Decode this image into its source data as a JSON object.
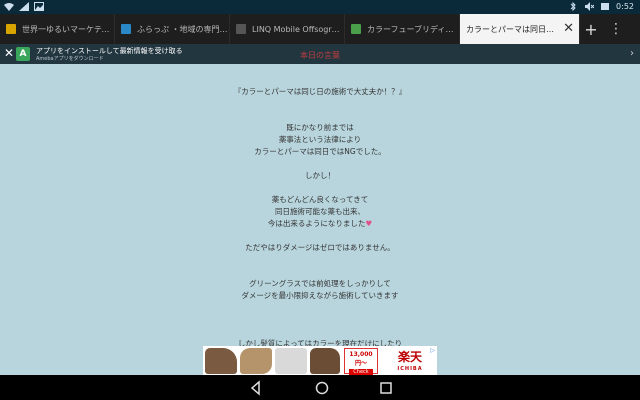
{
  "status_bar": {
    "time": "0:52",
    "icons": [
      "wifi-icon",
      "signal-icon",
      "photo-icon",
      "bluetooth-icon",
      "mute-icon",
      "battery-icon"
    ]
  },
  "tabs": [
    {
      "label": "世界一ゆるいマーケティン…",
      "favicon_color": "#d9a400",
      "active": false
    },
    {
      "label": "ふらっぷ ・地域の専門…",
      "favicon_color": "#2b88c7",
      "active": false
    },
    {
      "label": "LINQ Mobile Offsogroen…",
      "favicon_color": "#555555",
      "active": false
    },
    {
      "label": "カラーフューブリディク…",
      "favicon_color": "#4aa04a",
      "active": false
    },
    {
      "label": "カラーとパーマは同日に日…",
      "favicon_color": "#ffffff",
      "active": true
    }
  ],
  "banner": {
    "title": "アプリをインストールして最新情報を受け取る",
    "subtitle": "Amebaアプリをダウンロード"
  },
  "page": {
    "title": "本日の言葉",
    "lines": [
      "『カラーとパーマは同じ日の施術で大丈夫か！？』",
      "",
      "",
      "既にかなり前までは",
      "薬事法という法律により",
      "カラーとパーマは同日ではNGでした。",
      "",
      "しかし！",
      "",
      "薬もどんどん良くなってきて",
      "同日施術可能な薬も出来、",
      "今は出来るようになりました",
      "",
      "ただやはりダメージはゼロではありません。",
      "",
      "",
      "グリーングラスでは前処理をしっかりして",
      "ダメージを最小限抑えながら施術していきます",
      "",
      "",
      "",
      "しかし髪質によってはカラーを現在だけにしたり"
    ]
  },
  "ad": {
    "price": "13,000円〜",
    "cta": "Check",
    "logo": "楽天",
    "logo_sub": "ICHIBA"
  }
}
